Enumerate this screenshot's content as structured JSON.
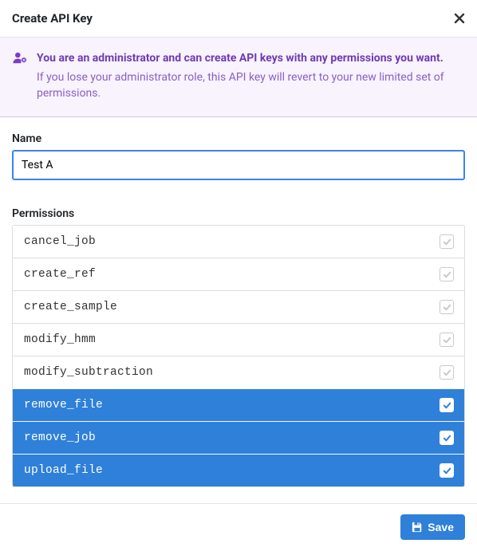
{
  "header": {
    "title": "Create API Key"
  },
  "alert": {
    "strong": "You are an administrator and can create API keys with any permissions you want.",
    "sub": "If you lose your administrator role, this API key will revert to your new limited set of permissions."
  },
  "form": {
    "name_label": "Name",
    "name_value": "Test A",
    "permissions_label": "Permissions"
  },
  "permissions": [
    {
      "name": "cancel_job",
      "checked": false
    },
    {
      "name": "create_ref",
      "checked": false
    },
    {
      "name": "create_sample",
      "checked": false
    },
    {
      "name": "modify_hmm",
      "checked": false
    },
    {
      "name": "modify_subtraction",
      "checked": false
    },
    {
      "name": "remove_file",
      "checked": true
    },
    {
      "name": "remove_job",
      "checked": true
    },
    {
      "name": "upload_file",
      "checked": true
    }
  ],
  "footer": {
    "save_label": "Save"
  }
}
